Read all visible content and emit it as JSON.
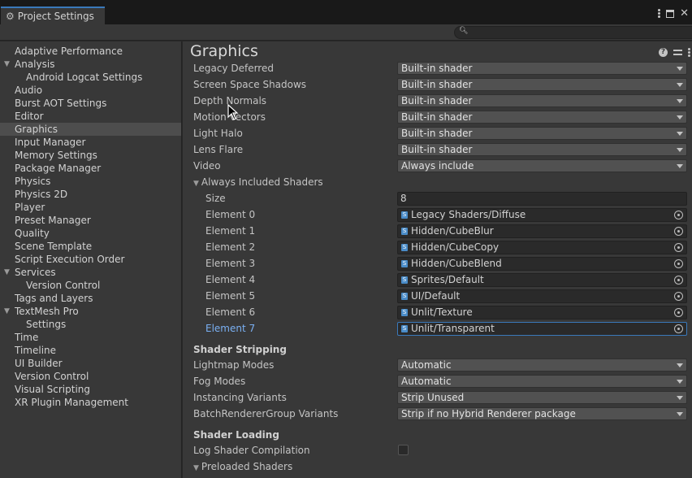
{
  "window": {
    "tab_title": "Project Settings",
    "search": {
      "placeholder": "",
      "value": ""
    }
  },
  "sidebar": {
    "items": [
      {
        "label": "Adaptive Performance",
        "level": 0,
        "expandable": false
      },
      {
        "label": "Analysis",
        "level": 0,
        "expandable": true
      },
      {
        "label": "Android Logcat Settings",
        "level": 1,
        "expandable": false
      },
      {
        "label": "Audio",
        "level": 0,
        "expandable": false
      },
      {
        "label": "Burst AOT Settings",
        "level": 0,
        "expandable": false
      },
      {
        "label": "Editor",
        "level": 0,
        "expandable": false
      },
      {
        "label": "Graphics",
        "level": 0,
        "expandable": false,
        "selected": true
      },
      {
        "label": "Input Manager",
        "level": 0,
        "expandable": false
      },
      {
        "label": "Memory Settings",
        "level": 0,
        "expandable": false
      },
      {
        "label": "Package Manager",
        "level": 0,
        "expandable": false
      },
      {
        "label": "Physics",
        "level": 0,
        "expandable": false
      },
      {
        "label": "Physics 2D",
        "level": 0,
        "expandable": false
      },
      {
        "label": "Player",
        "level": 0,
        "expandable": false
      },
      {
        "label": "Preset Manager",
        "level": 0,
        "expandable": false
      },
      {
        "label": "Quality",
        "level": 0,
        "expandable": false
      },
      {
        "label": "Scene Template",
        "level": 0,
        "expandable": false
      },
      {
        "label": "Script Execution Order",
        "level": 0,
        "expandable": false
      },
      {
        "label": "Services",
        "level": 0,
        "expandable": true
      },
      {
        "label": "Version Control",
        "level": 1,
        "expandable": false
      },
      {
        "label": "Tags and Layers",
        "level": 0,
        "expandable": false
      },
      {
        "label": "TextMesh Pro",
        "level": 0,
        "expandable": true
      },
      {
        "label": "Settings",
        "level": 1,
        "expandable": false
      },
      {
        "label": "Time",
        "level": 0,
        "expandable": false
      },
      {
        "label": "Timeline",
        "level": 0,
        "expandable": false
      },
      {
        "label": "UI Builder",
        "level": 0,
        "expandable": false
      },
      {
        "label": "Version Control",
        "level": 0,
        "expandable": false
      },
      {
        "label": "Visual Scripting",
        "level": 0,
        "expandable": false
      },
      {
        "label": "XR Plugin Management",
        "level": 0,
        "expandable": false
      }
    ]
  },
  "main": {
    "title": "Graphics",
    "built_in_settings": [
      {
        "label": "Legacy Deferred",
        "value": "Built-in shader"
      },
      {
        "label": "Screen Space Shadows",
        "value": "Built-in shader"
      },
      {
        "label": "Depth Normals",
        "value": "Built-in shader"
      },
      {
        "label": "Motion Vectors",
        "value": "Built-in shader"
      },
      {
        "label": "Light Halo",
        "value": "Built-in shader"
      },
      {
        "label": "Lens Flare",
        "value": "Built-in shader"
      },
      {
        "label": "Video",
        "value": "Always include"
      }
    ],
    "always_included": {
      "label": "Always Included Shaders",
      "size_label": "Size",
      "size_value": "8",
      "elements": [
        {
          "label": "Element 0",
          "value": "Legacy Shaders/Diffuse"
        },
        {
          "label": "Element 1",
          "value": "Hidden/CubeBlur"
        },
        {
          "label": "Element 2",
          "value": "Hidden/CubeCopy"
        },
        {
          "label": "Element 3",
          "value": "Hidden/CubeBlend"
        },
        {
          "label": "Element 4",
          "value": "Sprites/Default"
        },
        {
          "label": "Element 5",
          "value": "UI/Default"
        },
        {
          "label": "Element 6",
          "value": "Unlit/Texture"
        },
        {
          "label": "Element 7",
          "value": "Unlit/Transparent",
          "focused": true
        }
      ]
    },
    "shader_stripping": {
      "header": "Shader Stripping",
      "settings": [
        {
          "label": "Lightmap Modes",
          "value": "Automatic"
        },
        {
          "label": "Fog Modes",
          "value": "Automatic"
        },
        {
          "label": "Instancing Variants",
          "value": "Strip Unused"
        },
        {
          "label": "BatchRendererGroup Variants",
          "value": "Strip if no Hybrid Renderer package"
        }
      ]
    },
    "shader_loading": {
      "header": "Shader Loading",
      "log_label": "Log Shader Compilation",
      "log_checked": false,
      "preloaded_label": "Preloaded Shaders"
    }
  }
}
